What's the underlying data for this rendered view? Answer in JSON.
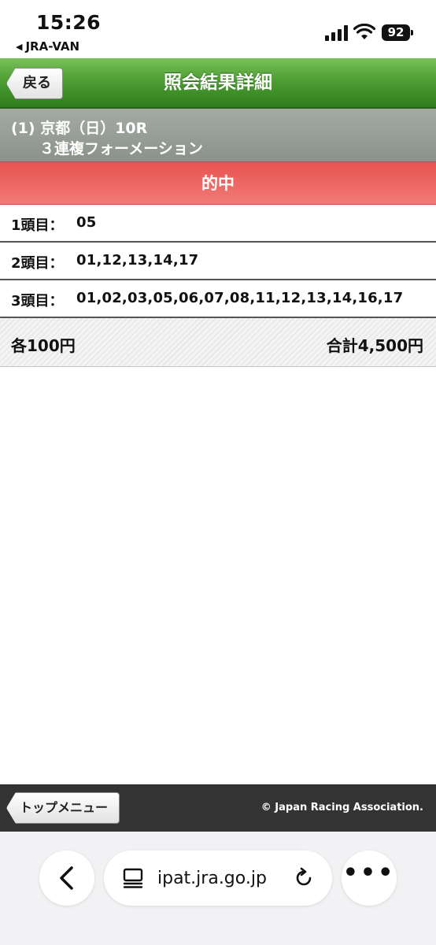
{
  "status_bar": {
    "time": "15:26",
    "back_app": "JRA-VAN",
    "battery": "92"
  },
  "header": {
    "back_label": "戻る",
    "title": "照会結果詳細"
  },
  "race": {
    "line1": "(1) 京都（日）10R",
    "line2": "３連複フォーメーション"
  },
  "result": {
    "banner": "的中"
  },
  "rows": [
    {
      "label": "1頭目：",
      "value": "05"
    },
    {
      "label": "2頭目：",
      "value": "01,12,13,14,17"
    },
    {
      "label": "3頭目：",
      "value": "01,02,03,05,06,07,08,11,12,13,14,16,17"
    }
  ],
  "totals": {
    "each": "各100円",
    "total": "合計4,500円"
  },
  "footer": {
    "top_menu": "トップメニュー",
    "copyright": "© Japan Racing Association."
  },
  "browser": {
    "url": "ipat.jra.go.jp"
  },
  "colors": {
    "header_green": "#4d9e33",
    "race_gray": "#8b918b",
    "hit_red": "#e85350",
    "footer_dark": "#333333"
  }
}
